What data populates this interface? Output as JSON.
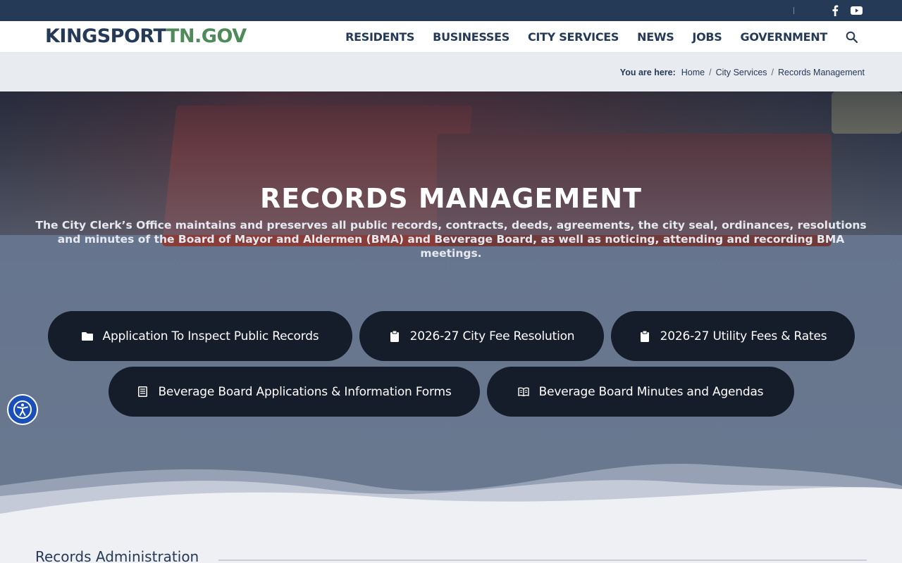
{
  "topbar": {
    "social": [
      {
        "icon": "facebook-icon"
      },
      {
        "icon": "youtube-icon"
      }
    ]
  },
  "header": {
    "logo_part1": "KINGSPORT",
    "logo_part2": "TN.GOV",
    "nav": [
      "RESIDENTS",
      "BUSINESSES",
      "CITY SERVICES",
      "NEWS",
      "JOBS",
      "GOVERNMENT"
    ],
    "search_icon": "search-icon"
  },
  "breadcrumb": {
    "label": "You are here:",
    "items": [
      "Home",
      "City Services",
      "Records Management"
    ]
  },
  "hero": {
    "title": "RECORDS MANAGEMENT",
    "description": "The City Clerk’s Office maintains and preserves all public records, contracts, deeds, agreements, the city seal, ordinances, resolutions and minutes of the Board of Mayor and Aldermen (BMA) and Beverage Board, as well as noticing, attending and recording BMA meetings."
  },
  "buttons": [
    {
      "label": "Application To Inspect Public Records",
      "icon": "folder-icon"
    },
    {
      "label": "2026-27 City Fee Resolution",
      "icon": "clipboard-icon"
    },
    {
      "label": "2026-27 Utility Fees & Rates",
      "icon": "clipboard-icon"
    },
    {
      "label": "Beverage Board Applications & Information Forms",
      "icon": "document-icon"
    },
    {
      "label": "Beverage Board Minutes and Agendas",
      "icon": "book-open-icon"
    }
  ],
  "section": {
    "title": "Records Administration"
  },
  "colors": {
    "navy": "#253a57",
    "green": "#4f8a5b",
    "pill": "#151c2a",
    "accessibility": "#1a4fb8"
  }
}
